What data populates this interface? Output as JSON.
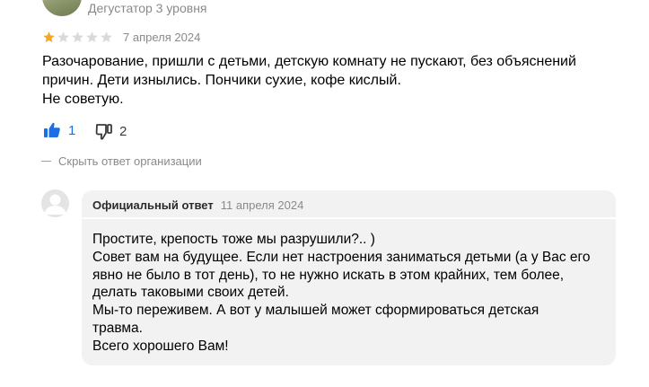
{
  "review": {
    "author_level": "Дегустатор 3 уровня",
    "rating": {
      "value": 1,
      "max": 5
    },
    "date": "7 апреля 2024",
    "text_lines": [
      "Разочарование, пришли с детьми, детскую комнату не пускают, без объяснений",
      "причин. Дети изнылись. Пончики сухие, кофе кислый.",
      "Не советую."
    ],
    "likes": "1",
    "dislikes": "2"
  },
  "hide_toggle": {
    "label": "Скрыть ответ организации"
  },
  "reply": {
    "title": "Официальный ответ",
    "date": "11 апреля 2024",
    "text_lines": [
      "Простите, крепость тоже мы разрушили?.. )",
      "Совет вам на будущее. Если нет настроения заниматься детьми (а у Вас его",
      "явно не было в тот день), то не нужно искать в этом крайних, тем более,",
      "делать таковыми своих детей.",
      "Мы-то переживем. А вот у малышей может сформироваться детская",
      "травма.",
      "Всего хорошего Вам!"
    ]
  },
  "colors": {
    "star_filled": "#f5a623",
    "star_empty": "#dadada",
    "like_active": "#1a6fe8",
    "reply_bg": "#f2f2f2",
    "muted_text": "#8a8a8a"
  },
  "icons": {
    "like": "thumbs-up-icon",
    "dislike": "thumbs-down-icon",
    "org_avatar": "user-silhouette-icon",
    "star": "star-icon"
  }
}
